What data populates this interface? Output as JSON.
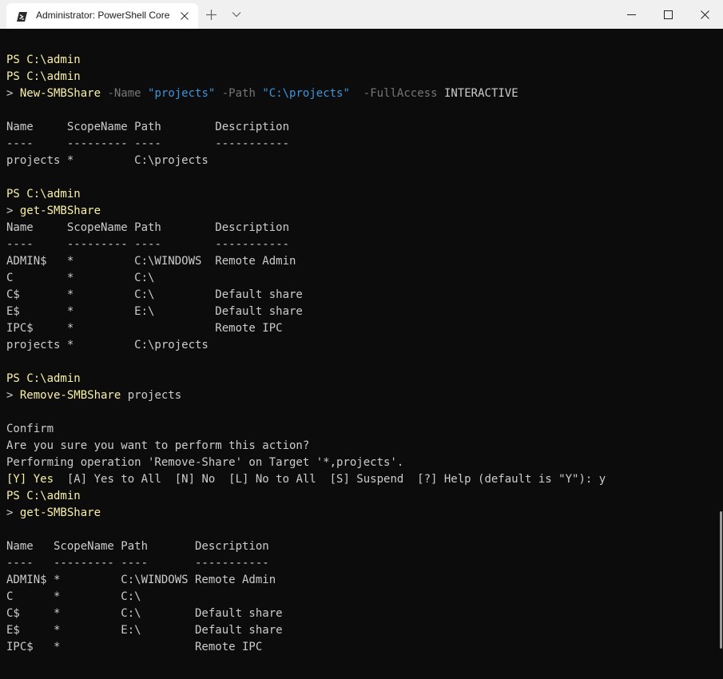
{
  "window": {
    "tab_title": "Administrator: PowerShell Core",
    "icons": {
      "tab": "powershell-icon",
      "close_tab": "close-icon",
      "new_tab": "plus-icon",
      "dropdown": "chevron-down-icon",
      "minimize": "minimize-icon",
      "maximize": "maximize-icon",
      "close_window": "close-icon"
    }
  },
  "colors": {
    "terminal_bg": "#0c0c0c",
    "default_text": "#cccccc",
    "prompt_and_command": "#f9f1a5",
    "parameter": "#767676",
    "string": "#3a96dd",
    "titlebar": "#f0f0f0"
  },
  "terminal": {
    "lines": [
      [
        {
          "t": "PS C:\\admin",
          "c": "ps"
        }
      ],
      [
        {
          "t": "PS C:\\admin",
          "c": "ps"
        }
      ],
      [
        {
          "t": "> ",
          "c": "gt"
        },
        {
          "t": "New-SMBShare",
          "c": "cmd"
        },
        {
          "t": " -Name ",
          "c": "param"
        },
        {
          "t": "\"projects\"",
          "c": "str"
        },
        {
          "t": " -Path ",
          "c": "param"
        },
        {
          "t": "\"C:\\projects\"",
          "c": "str"
        },
        {
          "t": "  -FullAccess ",
          "c": "param"
        },
        {
          "t": "INTERACTIVE",
          "c": "text"
        }
      ],
      [],
      [
        {
          "t": "Name     ScopeName Path        Description",
          "c": "text"
        }
      ],
      [
        {
          "t": "----     --------- ----        -----------",
          "c": "text"
        }
      ],
      [
        {
          "t": "projects *         C:\\projects",
          "c": "text"
        }
      ],
      [],
      [
        {
          "t": "PS C:\\admin",
          "c": "ps"
        }
      ],
      [
        {
          "t": "> ",
          "c": "gt"
        },
        {
          "t": "get-SMBShare",
          "c": "cmd"
        }
      ],
      [
        {
          "t": "Name     ScopeName Path        Description",
          "c": "text"
        }
      ],
      [
        {
          "t": "----     --------- ----        -----------",
          "c": "text"
        }
      ],
      [
        {
          "t": "ADMIN$   *         C:\\WINDOWS  Remote Admin",
          "c": "text"
        }
      ],
      [
        {
          "t": "C        *         C:\\",
          "c": "text"
        }
      ],
      [
        {
          "t": "C$       *         C:\\         Default share",
          "c": "text"
        }
      ],
      [
        {
          "t": "E$       *         E:\\         Default share",
          "c": "text"
        }
      ],
      [
        {
          "t": "IPC$     *                     Remote IPC",
          "c": "text"
        }
      ],
      [
        {
          "t": "projects *         C:\\projects",
          "c": "text"
        }
      ],
      [],
      [
        {
          "t": "PS C:\\admin",
          "c": "ps"
        }
      ],
      [
        {
          "t": "> ",
          "c": "gt"
        },
        {
          "t": "Remove-SMBShare",
          "c": "cmd"
        },
        {
          "t": " projects",
          "c": "text"
        }
      ],
      [],
      [
        {
          "t": "Confirm",
          "c": "text"
        }
      ],
      [
        {
          "t": "Are you sure you want to perform this action?",
          "c": "text"
        }
      ],
      [
        {
          "t": "Performing operation 'Remove-Share' on Target '*,projects'.",
          "c": "text"
        }
      ],
      [
        {
          "t": "[Y] Yes",
          "c": "ps"
        },
        {
          "t": "  [A] Yes to All  [N] No  [L] No to All  [S] Suspend  [?] Help (default is \"Y\"): y",
          "c": "text"
        }
      ],
      [
        {
          "t": "PS C:\\admin",
          "c": "ps"
        }
      ],
      [
        {
          "t": "> ",
          "c": "gt"
        },
        {
          "t": "get-SMBShare",
          "c": "cmd"
        }
      ],
      [],
      [
        {
          "t": "Name   ScopeName Path       Description",
          "c": "text"
        }
      ],
      [
        {
          "t": "----   --------- ----       -----------",
          "c": "text"
        }
      ],
      [
        {
          "t": "ADMIN$ *         C:\\WINDOWS Remote Admin",
          "c": "text"
        }
      ],
      [
        {
          "t": "C      *         C:\\",
          "c": "text"
        }
      ],
      [
        {
          "t": "C$     *         C:\\        Default share",
          "c": "text"
        }
      ],
      [
        {
          "t": "E$     *         E:\\        Default share",
          "c": "text"
        }
      ],
      [
        {
          "t": "IPC$   *                    Remote IPC",
          "c": "text"
        }
      ]
    ]
  }
}
